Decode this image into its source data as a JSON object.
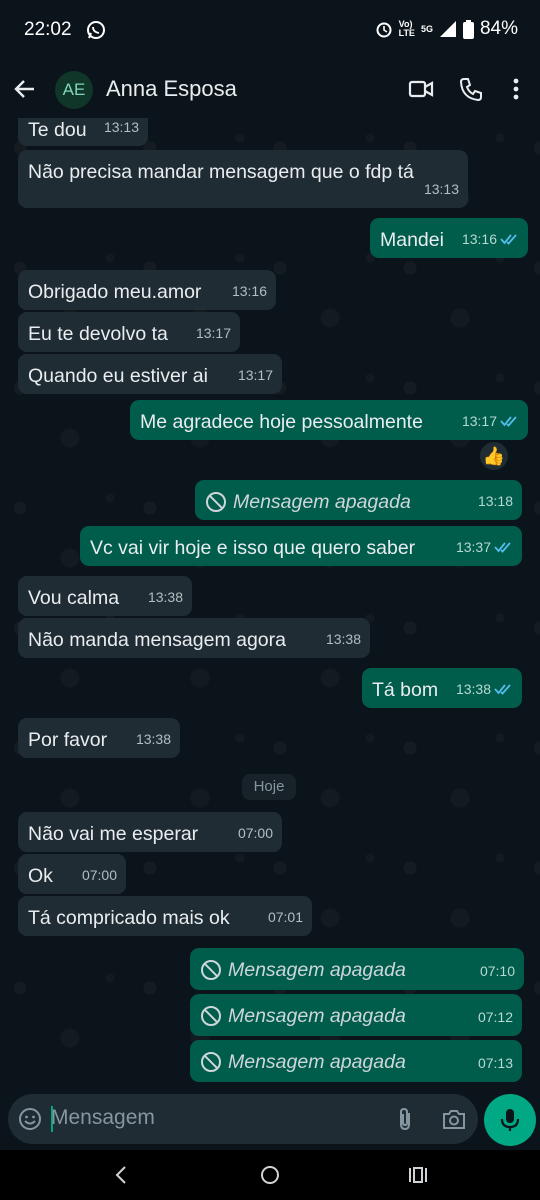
{
  "status_bar": {
    "time": "22:02",
    "network_top": "Vo)",
    "network_bottom": "LTE",
    "network_type": "5G",
    "battery": "84%"
  },
  "header": {
    "avatar_initials": "AE",
    "contact_name": "Anna Esposa"
  },
  "messages": [
    {
      "dir": "in",
      "text": "Te dou",
      "time": "13:13"
    },
    {
      "dir": "in",
      "text": "Não precisa mandar mensagem que o fdp tá",
      "time": "13:13"
    },
    {
      "dir": "out",
      "text": "Mandei",
      "time": "13:16"
    },
    {
      "dir": "in",
      "text": "Obrigado meu.amor",
      "time": "13:16"
    },
    {
      "dir": "in",
      "text": "Eu te devolvo ta",
      "time": "13:17"
    },
    {
      "dir": "in",
      "text": "Quando eu estiver ai",
      "time": "13:17"
    },
    {
      "dir": "out",
      "text": "Me agradece hoje pessoalmente",
      "time": "13:17",
      "reaction": "👍"
    },
    {
      "dir": "out",
      "text": "Mensagem apagada",
      "time": "13:18",
      "deleted": true
    },
    {
      "dir": "out",
      "text": "Vc vai vir hoje e isso que quero saber",
      "time": "13:37"
    },
    {
      "dir": "in",
      "text": "Vou calma",
      "time": "13:38"
    },
    {
      "dir": "in",
      "text": "Não manda mensagem agora",
      "time": "13:38"
    },
    {
      "dir": "out",
      "text": "Tá bom",
      "time": "13:38"
    },
    {
      "dir": "in",
      "text": "Por favor",
      "time": "13:38"
    },
    {
      "dir": "in",
      "text": "Não vai me esperar",
      "time": "07:00"
    },
    {
      "dir": "in",
      "text": "Ok",
      "time": "07:00"
    },
    {
      "dir": "in",
      "text": "Tá compricado mais ok",
      "time": "07:01"
    },
    {
      "dir": "out",
      "text": "Mensagem apagada",
      "time": "07:10",
      "deleted": true
    },
    {
      "dir": "out",
      "text": "Mensagem apagada",
      "time": "07:12",
      "deleted": true
    },
    {
      "dir": "out",
      "text": "Mensagem apagada",
      "time": "07:13",
      "deleted": true
    }
  ],
  "date_divider": "Hoje",
  "composer": {
    "placeholder": "Mensagem"
  },
  "colors": {
    "incoming": "#202c33",
    "outgoing": "#005c4b",
    "accent": "#00a884",
    "read_tick": "#53bdeb"
  }
}
